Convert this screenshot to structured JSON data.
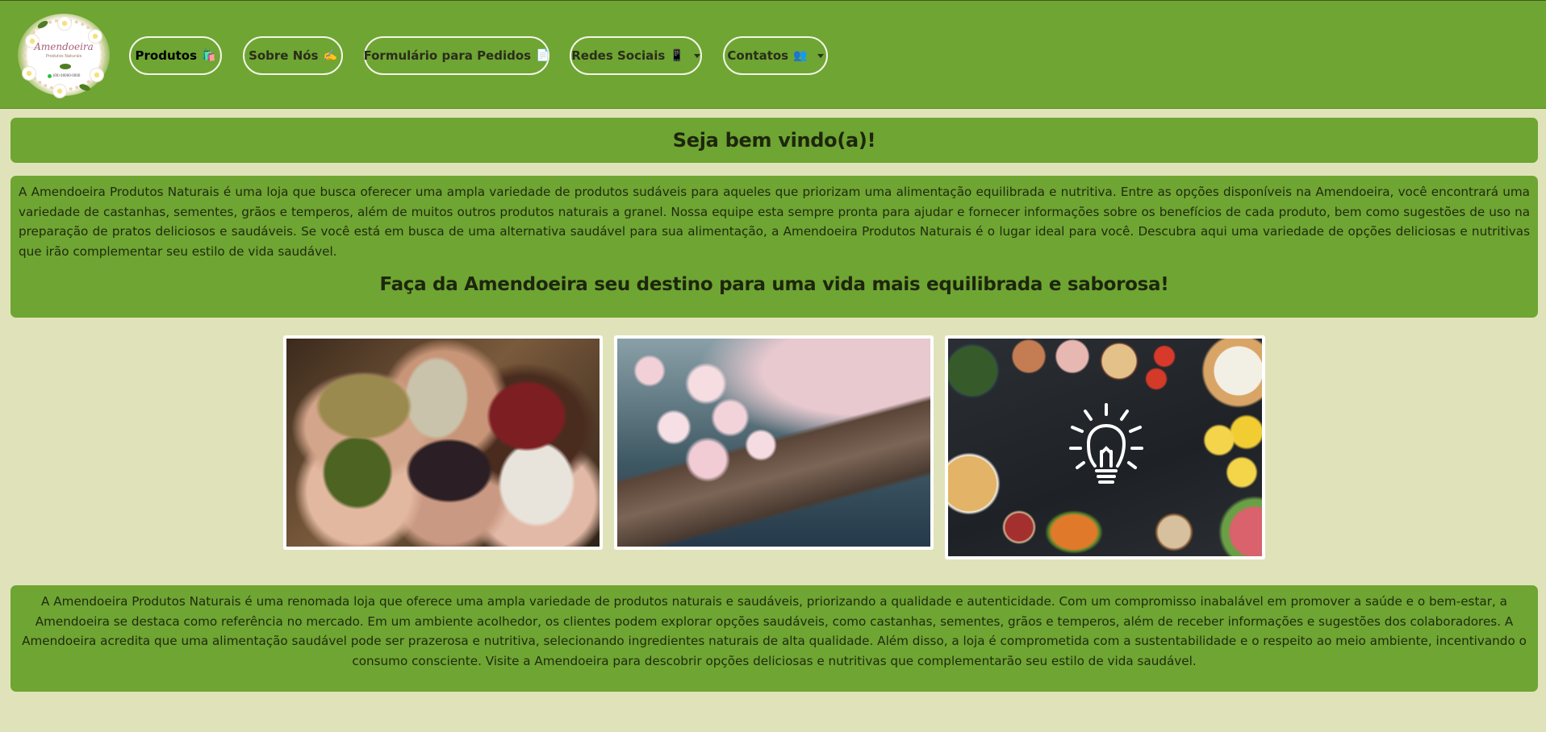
{
  "header": {
    "logo": {
      "brand": "Amendoeira",
      "tagline": "Produtos Naturais",
      "phone": "(00) 00000-0000"
    },
    "nav": [
      {
        "label": "Produtos",
        "emoji": "🛍️",
        "dropdown": false,
        "active": true
      },
      {
        "label": "Sobre Nós",
        "emoji": "✍️",
        "dropdown": false,
        "active": false
      },
      {
        "label": "Formulário para Pedidos",
        "emoji": "📄",
        "dropdown": false,
        "active": false
      },
      {
        "label": "Redes Sociais",
        "emoji": "📱",
        "dropdown": true,
        "active": false
      },
      {
        "label": "Contatos",
        "emoji": "👥",
        "dropdown": true,
        "active": false
      }
    ]
  },
  "welcome": {
    "title": "Seja bem vindo(a)!"
  },
  "intro": {
    "text": "A Amendoeira Produtos Naturais é uma loja que busca oferecer uma ampla variedade de produtos sudáveis para aqueles que priorizam uma alimentação equilibrada e nutritiva. Entre as opções disponíveis na Amendoeira, você encontrará uma variedade de castanhas, sementes, grãos e temperos, além de muitos outros produtos naturais a granel. Nossa equipe esta sempre pronta para ajudar e fornecer informações sobre os benefícios de cada produto, bem como sugestões de uso na preparação de pratos deliciosos e saudáveis. Se você está em busca de uma alternativa saudável para sua alimentação, a Amendoeira Produtos Naturais é o lugar ideal para você. Descubra aqui uma variedade de opções deliciosas e nutritivas que irão complementar seu estilo de vida saudável.",
    "tagline": "Faça da Amendoeira seu destino para uma vida mais equilibrada e saborosa!"
  },
  "gallery": [
    {
      "subject": "hands-with-grains"
    },
    {
      "subject": "cherry-blossoms"
    },
    {
      "subject": "healthy-food-idea"
    }
  ],
  "about": {
    "text": "A Amendoeira Produtos Naturais é uma renomada loja que oferece uma ampla variedade de produtos naturais e saudáveis, priorizando a qualidade e autenticidade. Com um compromisso inabalável em promover a saúde e o bem-estar, a Amendoeira se destaca como referência no mercado. Em um ambiente acolhedor, os clientes podem explorar opções saudáveis, como castanhas, sementes, grãos e temperos, além de receber informações e sugestões dos colaboradores. A Amendoeira acredita que uma alimentação saudável pode ser prazerosa e nutritiva, selecionando ingredientes naturais de alta qualidade. Além disso, a loja é comprometida com a sustentabilidade e o respeito ao meio ambiente, incentivando o consumo consciente. Visite a Amendoeira para descobrir opções deliciosas e nutritivas que complementarão seu estilo de vida saudável."
  },
  "colors": {
    "page_background": "#e0e3ba",
    "green_panel": "#6fa532",
    "nav_border": "#f3f5ea",
    "text": "#1f2a10"
  }
}
